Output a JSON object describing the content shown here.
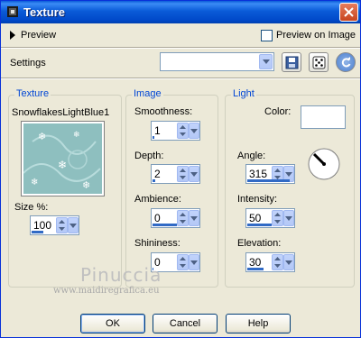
{
  "window": {
    "title": "Texture"
  },
  "preview": {
    "label": "Preview",
    "preview_on_image_label": "Preview on Image",
    "preview_on_image_checked": false
  },
  "settings": {
    "label": "Settings",
    "preset_value": ""
  },
  "texture_group": {
    "title": "Texture",
    "name": "SnowflakesLightBlue1",
    "size_label": "Size %:",
    "size_value": "100"
  },
  "image_group": {
    "title": "Image",
    "smoothness_label": "Smoothness:",
    "smoothness_value": "1",
    "depth_label": "Depth:",
    "depth_value": "2",
    "ambience_label": "Ambience:",
    "ambience_value": "0",
    "shininess_label": "Shininess:",
    "shininess_value": "0"
  },
  "light_group": {
    "title": "Light",
    "color_label": "Color:",
    "color_value": "#ffffff",
    "angle_label": "Angle:",
    "angle_value": "315",
    "intensity_label": "Intensity:",
    "intensity_value": "50",
    "elevation_label": "Elevation:",
    "elevation_value": "30"
  },
  "watermark": {
    "name": "Pinuccia",
    "url": "www.maidiregrafica.eu"
  },
  "buttons": {
    "ok": "OK",
    "cancel": "Cancel",
    "help": "Help"
  }
}
